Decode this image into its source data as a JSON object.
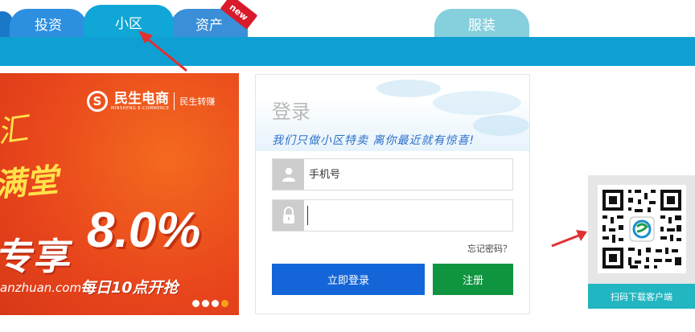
{
  "tabs": {
    "invest": "投资",
    "community": "小区",
    "assets": "资产",
    "new_badge": "new",
    "clothing": "服装"
  },
  "banner": {
    "brand_name": "民生电商",
    "brand_sub": "MINSHENG E-COMMERCE",
    "brand_side": "民生转赚",
    "rate": "8.0%",
    "enjoy_text": "专享",
    "script_line1": "汇",
    "script_line2": "满堂",
    "domain": "anzhuan.com",
    "daily_text": "每日10点开抢",
    "slides_count": 4,
    "active_slide": 4
  },
  "login": {
    "title": "登录",
    "slogan": "我们只做小区特卖  离你最近就有惊喜!",
    "phone_placeholder": "手机号",
    "password_value": "",
    "forgot_label": "忘记密码？",
    "login_button": "立即登录",
    "register_button": "注册"
  },
  "qr": {
    "caption": "扫码下载客户端"
  },
  "colors": {
    "nav_blue": "#109fd3",
    "login_blue": "#1466d8",
    "register_green": "#0f9440",
    "qr_teal": "#21b6c1",
    "arrow_red": "#e03030"
  }
}
